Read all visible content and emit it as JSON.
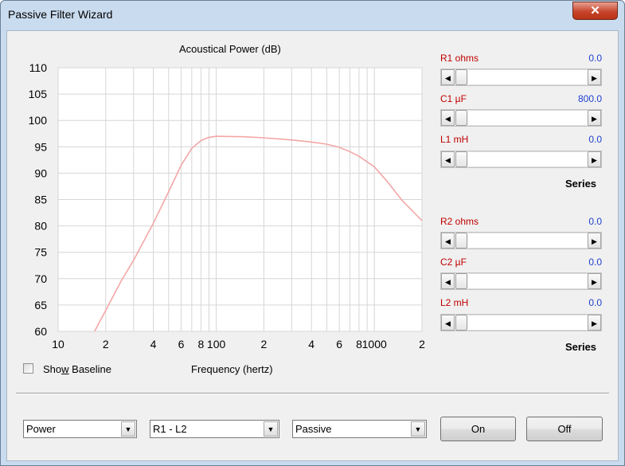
{
  "window": {
    "title": "Passive Filter Wizard",
    "close_glyph": "✕"
  },
  "chart": {
    "title": "Acoustical Power (dB)",
    "xlabel": "Frequency (hertz)",
    "curve_color": "#f4a6a6"
  },
  "chart_data": {
    "type": "line",
    "title": "Acoustical Power (dB)",
    "xlabel": "Frequency (hertz)",
    "ylabel": "",
    "xscale": "log",
    "xlim": [
      10,
      2000
    ],
    "ylim": [
      60,
      110
    ],
    "grid": true,
    "y_ticks": [
      110,
      105,
      100,
      95,
      90,
      85,
      80,
      75,
      70,
      65,
      60
    ],
    "x_ticks": [
      {
        "value": 10,
        "label": "10"
      },
      {
        "value": 20,
        "label": "2"
      },
      {
        "value": 40,
        "label": "4"
      },
      {
        "value": 60,
        "label": "6"
      },
      {
        "value": 80,
        "label": "8"
      },
      {
        "value": 100,
        "label": "100"
      },
      {
        "value": 200,
        "label": "2"
      },
      {
        "value": 400,
        "label": "4"
      },
      {
        "value": 600,
        "label": "6"
      },
      {
        "value": 800,
        "label": "8"
      },
      {
        "value": 1000,
        "label": "1000"
      },
      {
        "value": 2000,
        "label": "2"
      }
    ],
    "series": [
      {
        "x": [
          17,
          20,
          25,
          30,
          40,
          50,
          60,
          70,
          80,
          90,
          100,
          150,
          200,
          300,
          400,
          500,
          600,
          700,
          800,
          1000,
          1200,
          1500,
          2000
        ],
        "y": [
          60,
          64,
          69.5,
          73.5,
          80.5,
          86.5,
          91.5,
          94.7,
          96.2,
          96.8,
          97.0,
          96.9,
          96.7,
          96.3,
          95.9,
          95.5,
          94.9,
          94.1,
          93.2,
          91.2,
          88.5,
          84.8,
          81.0
        ]
      }
    ]
  },
  "sliders": [
    {
      "label": "R1  ohms",
      "value": "0.0"
    },
    {
      "label": "C1  µF",
      "value": "800.0"
    },
    {
      "label": "L1  mH",
      "value": "0.0"
    },
    {
      "label": "R2  ohms",
      "value": "0.0"
    },
    {
      "label": "C2  µF",
      "value": "0.0"
    },
    {
      "label": "L2  mH",
      "value": "0.0"
    }
  ],
  "series_labels": [
    "Series",
    "Series"
  ],
  "checkbox": {
    "label_pre": "Sho",
    "label_accel": "w",
    "label_post": " Baseline",
    "checked": false
  },
  "combos": [
    {
      "value": "Power"
    },
    {
      "value": "R1 - L2"
    },
    {
      "value": "Passive"
    }
  ],
  "buttons": {
    "on": "On",
    "off": "Off"
  },
  "glyphs": {
    "arrow_left": "◀",
    "arrow_right": "▶",
    "arrow_down": "▼"
  }
}
